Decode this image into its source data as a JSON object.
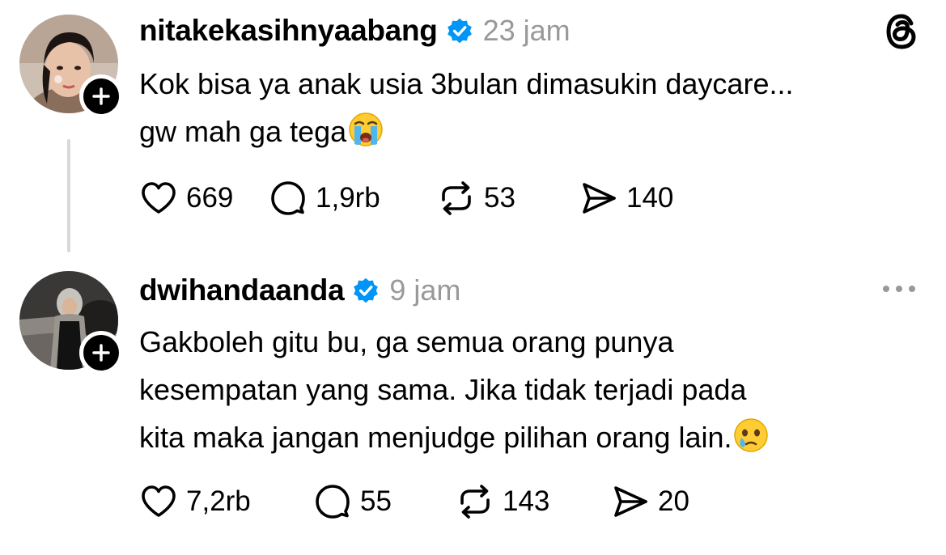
{
  "posts": [
    {
      "username": "nitakekasihnyaabang",
      "time": "23 jam",
      "lines": [
        "Kok bisa ya anak usia 3bulan dimasukin daycare...",
        "gw mah ga tega"
      ],
      "emoji": "loudly-crying-face",
      "counts": {
        "likes": "669",
        "replies": "1,9rb",
        "reposts": "53",
        "shares": "140"
      }
    },
    {
      "username": "dwihandaanda",
      "time": "9 jam",
      "lines": [
        "Gakboleh gitu bu, ga semua orang punya",
        "kesempatan yang sama. Jika tidak terjadi pada",
        "kita maka jangan menjudge pilihan orang lain."
      ],
      "emoji": "face-holding-back-tears",
      "counts": {
        "likes": "7,2rb",
        "replies": "55",
        "reposts": "143",
        "shares": "20"
      }
    }
  ],
  "colors": {
    "verified_badge": "#0095f6",
    "timestamp": "#999999",
    "thread_line": "#d9d9d9",
    "text": "#000000"
  },
  "icons": [
    "threads-logo-icon",
    "verified-badge-icon",
    "heart-icon",
    "comment-icon",
    "repost-icon",
    "share-icon",
    "more-options-icon",
    "plus-icon"
  ]
}
